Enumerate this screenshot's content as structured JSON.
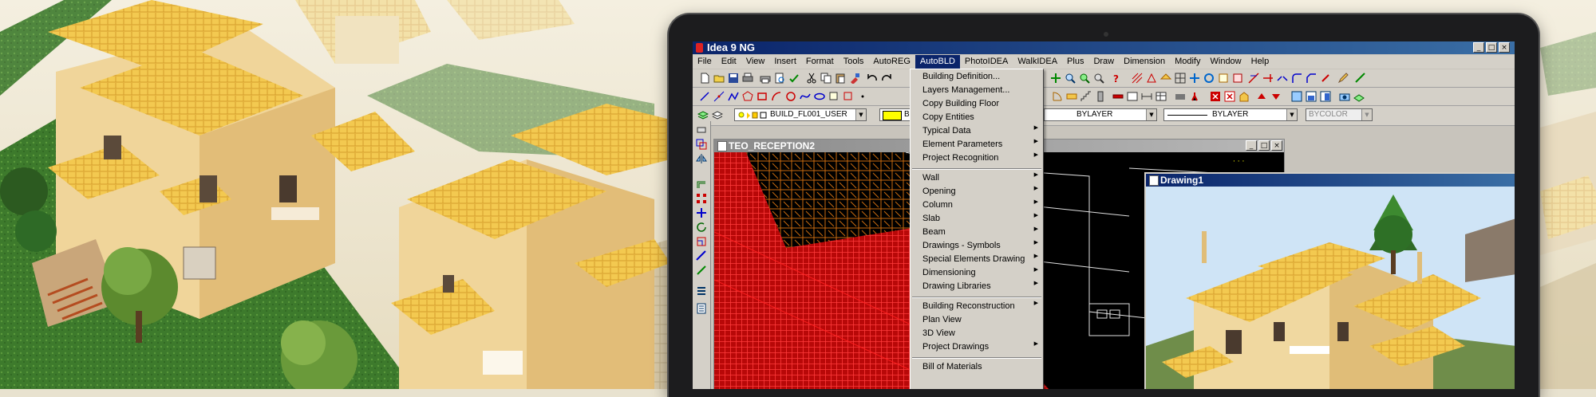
{
  "window": {
    "title": "Idea 9 NG",
    "controls": [
      "_",
      "□",
      "×"
    ]
  },
  "menubar": {
    "items": [
      "File",
      "Edit",
      "View",
      "Insert",
      "Format",
      "Tools",
      "AutoREG",
      "AutoBLD",
      "PhotoIDEA",
      "WalkIDEA",
      "Plus",
      "Draw",
      "Dimension",
      "Modify",
      "Window",
      "Help"
    ],
    "active": "AutoBLD"
  },
  "autobld_menu": {
    "group1": [
      {
        "label": "Building Definition...",
        "submenu": false
      },
      {
        "label": "Layers Management...",
        "submenu": false
      },
      {
        "label": "Copy Building Floor",
        "submenu": false
      },
      {
        "label": "Copy Entities",
        "submenu": false
      },
      {
        "label": "Typical Data",
        "submenu": true
      },
      {
        "label": "Element Parameters",
        "submenu": true
      },
      {
        "label": "Project Recognition",
        "submenu": true
      }
    ],
    "group2": [
      {
        "label": "Wall",
        "submenu": true
      },
      {
        "label": "Opening",
        "submenu": true
      },
      {
        "label": "Column",
        "submenu": true
      },
      {
        "label": "Slab",
        "submenu": true
      },
      {
        "label": "Beam",
        "submenu": true
      },
      {
        "label": "Drawings - Symbols",
        "submenu": true
      },
      {
        "label": "Special Elements Drawing",
        "submenu": true
      },
      {
        "label": "Dimensioning",
        "submenu": true
      },
      {
        "label": "Drawing Libraries",
        "submenu": true
      }
    ],
    "group3": [
      {
        "label": "Building Reconstruction",
        "submenu": true
      },
      {
        "label": "Plan View",
        "submenu": false
      },
      {
        "label": "3D View",
        "submenu": false
      },
      {
        "label": "Project Drawings",
        "submenu": true
      }
    ],
    "group4": [
      {
        "label": "Bill of Materials",
        "submenu": false
      }
    ]
  },
  "properties_bar": {
    "layer": "BUILD_FL001_USER",
    "color": "BY",
    "linetype": "BYLAYER",
    "lineweight": "BYLAYER",
    "plotstyle": "BYCOLOR"
  },
  "drawing_windows": [
    {
      "title": "TEO_RECEPTION2",
      "controls": [
        "_",
        "□",
        "×"
      ]
    },
    {
      "title": "Drawing1"
    }
  ],
  "colors": {
    "title_active": "#0a246a",
    "title_inactive": "#8a8a8a",
    "face": "#d4d0c8",
    "walls_red": "#cc1010",
    "roof": "#f2c64a"
  },
  "icons": [
    "new-icon",
    "open-icon",
    "save-icon",
    "print-icon",
    "cut-icon",
    "copy-icon",
    "paste-icon",
    "undo-icon",
    "redo-icon",
    "help-icon",
    "line-icon",
    "circle-icon",
    "arc-icon",
    "rectangle-icon",
    "layer-icon"
  ]
}
